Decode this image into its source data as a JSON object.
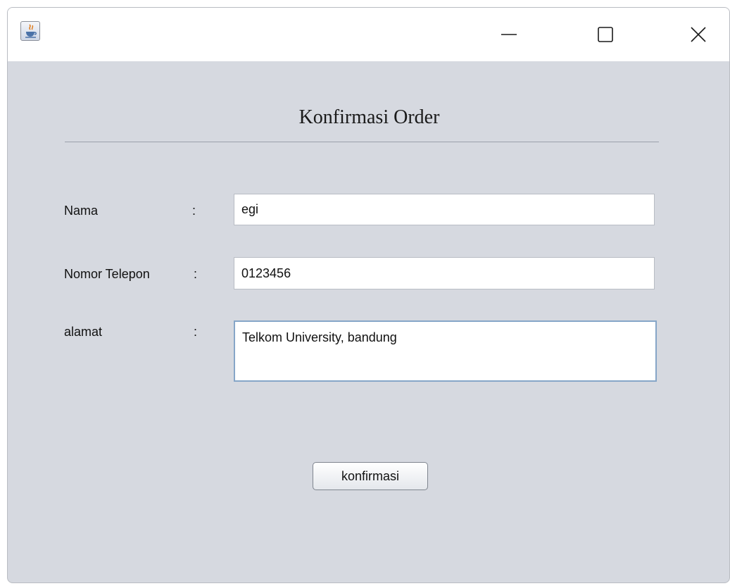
{
  "window": {
    "icon": "java-icon",
    "controls": [
      "minimize-icon",
      "maximize-icon",
      "close-icon"
    ]
  },
  "form": {
    "title": "Konfirmasi Order",
    "nama": {
      "label": "Nama",
      "colon": ":",
      "value": "egi"
    },
    "telepon": {
      "label": "Nomor Telepon",
      "colon": ":",
      "value": "0123456"
    },
    "alamat": {
      "label": "alamat",
      "colon": ":",
      "value": "Telkom University, bandung"
    },
    "confirm_label": "konfirmasi"
  },
  "colors": {
    "window_bg": "#d6d9e0",
    "titlebar_bg": "#ffffff",
    "focus_border": "#86a6c8"
  }
}
